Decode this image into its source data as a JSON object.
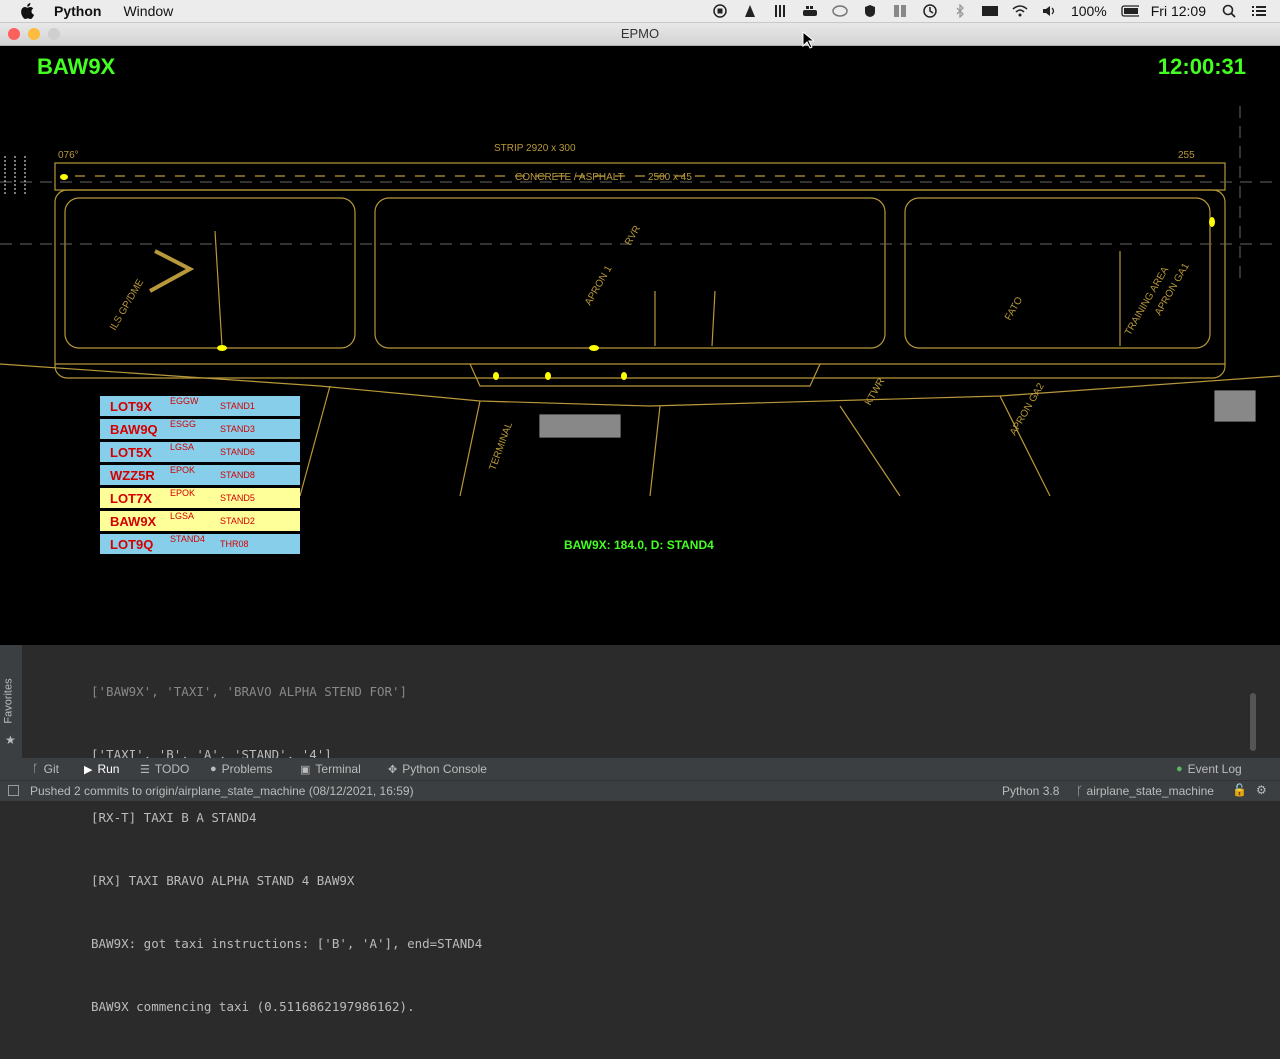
{
  "menubar": {
    "app_name": "Python",
    "menu_window": "Window",
    "battery": "100%",
    "clock": "Fri 12:09"
  },
  "window": {
    "title": "EPMO"
  },
  "radar": {
    "selected_callsign": "BAW9X",
    "clock": "12:00:31",
    "status": "BAW9X: 184.0, D: STAND4",
    "map_labels": {
      "strip": "STRIP 2920 x 300",
      "runway_surface": "CONCRETE / ASPHALT",
      "runway_dims": "2500 x 45",
      "apron1": "APRON 1",
      "fato": "FATO",
      "apron_ga1": "APRON GA1",
      "apron_ga2": "APRON GA2",
      "terminal": "TERMINAL",
      "training_area": "TRAINING AREA",
      "rvr": "RVR",
      "ktwr": "KTWR",
      "ils": "ILS GP/DME",
      "dist_076": "076°",
      "dist_255": "255"
    }
  },
  "strips": [
    {
      "callsign": "LOT9X",
      "from": "EGGW",
      "to": "STAND1",
      "color": "#87ceeb"
    },
    {
      "callsign": "BAW9Q",
      "from": "ESGG",
      "to": "STAND3",
      "color": "#87ceeb"
    },
    {
      "callsign": "LOT5X",
      "from": "LGSA",
      "to": "STAND6",
      "color": "#87ceeb"
    },
    {
      "callsign": "WZZ5R",
      "from": "EPOK",
      "to": "STAND8",
      "color": "#87ceeb"
    },
    {
      "callsign": "LOT7X",
      "from": "EPOK",
      "to": "STAND5",
      "color": "#ffff99"
    },
    {
      "callsign": "BAW9X",
      "from": "LGSA",
      "to": "STAND2",
      "color": "#ffff99"
    },
    {
      "callsign": "LOT9Q",
      "from": "STAND4",
      "to": "THR08",
      "color": "#87ceeb"
    }
  ],
  "console": {
    "lines": [
      "['BAW9X', 'TAXI', 'BRAVO ALPHA STEND FOR']",
      "['TAXI', 'B', 'A', 'STAND', '4']",
      "[RX-T] TAXI B A STAND4",
      "[RX] TAXI BRAVO ALPHA STAND 4 BAW9X",
      "BAW9X: got taxi instructions: ['B', 'A'], end=STAND4",
      "BAW9X commencing taxi (0.5116862197986162)."
    ],
    "favorites": "Favorites"
  },
  "tool_tabs": {
    "git": "Git",
    "run": "Run",
    "todo": "TODO",
    "problems": "Problems",
    "terminal": "Terminal",
    "python_console": "Python Console",
    "event_log": "Event Log"
  },
  "statusbar": {
    "message": "Pushed 2 commits to origin/airplane_state_machine (08/12/2021, 16:59)",
    "interpreter": "Python 3.8",
    "branch": "airplane_state_machine"
  },
  "colors": {
    "map_lines": "#b8983a",
    "aircraft": "#ffff00",
    "overlay_text": "#44ff22",
    "strip_text": "#d40000"
  }
}
